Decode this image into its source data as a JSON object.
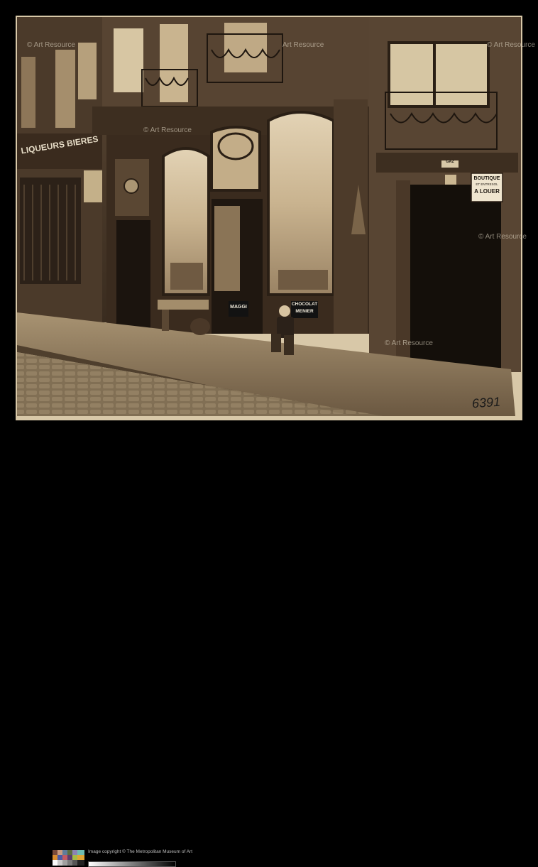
{
  "photo": {
    "shop_signs": {
      "street_sign": "LIQUEURS BIERES",
      "boutique": "BOUTIQUE",
      "boutique_sub": "ET ENTRESOL",
      "boutique_rent": "A LOUER",
      "maggi": "MAGGI",
      "chocolat": "CHOCOLAT",
      "menier": "MENIER",
      "gaz": "GAZ"
    },
    "negative_number": "6391",
    "watermarks": [
      "© Art Resource",
      "Art Resource",
      "© Art Resource",
      "© Art Resource",
      "© Art Resource",
      "© Art Resource"
    ]
  },
  "footer": {
    "credit": "Image copyright © The Metropolitan Museum of Art"
  },
  "colors": {
    "border": "#000000",
    "print_paper": "#d8c8a8",
    "sepia_dark": "#2a1f15",
    "sepia_mid": "#6b5641",
    "sepia_light": "#c2ac88"
  }
}
